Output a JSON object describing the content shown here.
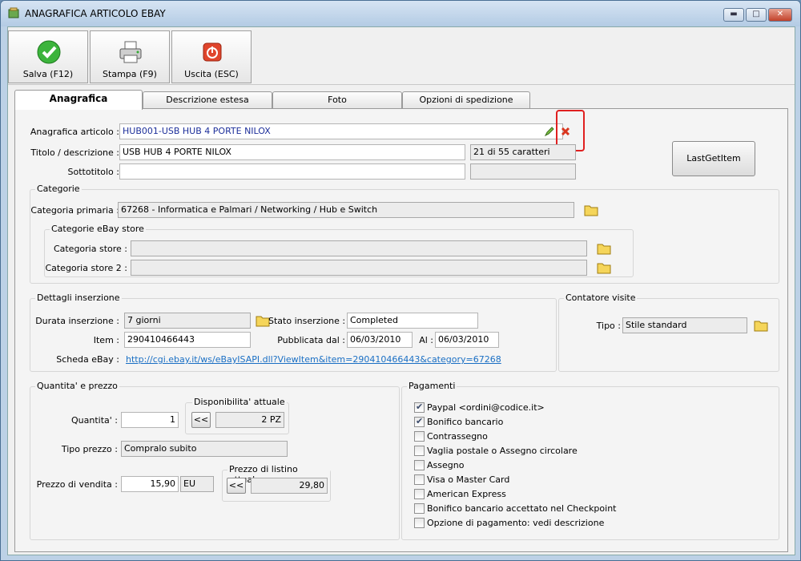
{
  "window": {
    "title": "ANAGRAFICA ARTICOLO EBAY",
    "minimize": "▬",
    "maximize": "□",
    "close": "✕"
  },
  "toolbar": {
    "save": "Salva (F12)",
    "print": "Stampa (F9)",
    "exit": "Uscita (ESC)"
  },
  "tabs": [
    "Anagrafica",
    "Descrizione estesa",
    "Foto",
    "Opzioni di spedizione"
  ],
  "anagrafica": {
    "article_label": "Anagrafica articolo :",
    "article_value": "HUB001-USB HUB 4 PORTE NILOX",
    "title_label": "Titolo / descrizione :",
    "title_value": "USB HUB 4 PORTE NILOX",
    "title_count": "21 di 55 caratteri",
    "subtitle_label": "Sottotitolo :",
    "subtitle_value": "",
    "last_get_item": "LastGetItem"
  },
  "categorie": {
    "group_title": "Categorie",
    "primary_label": "Categoria primaria :",
    "primary_value": "67268 - Informatica e Palmari / Networking / Hub e Switch",
    "store_group_title": "Categorie eBay store",
    "store_label": "Categoria store :",
    "store_value": "",
    "store2_label": "Categoria store 2 :",
    "store2_value": ""
  },
  "dettagli": {
    "group_title": "Dettagli inserzione",
    "duration_label": "Durata inserzione :",
    "duration_value": "7 giorni",
    "status_label": "Stato inserzione :",
    "status_value": "Completed",
    "item_label": "Item :",
    "item_value": "290410466443",
    "published_label": "Pubblicata dal :",
    "published_value": "06/03/2010",
    "to_label": "Al :",
    "to_value": "06/03/2010",
    "sheet_label": "Scheda eBay :",
    "sheet_link": "http://cgi.ebay.it/ws/eBayISAPI.dll?ViewItem&item=290410466443&category=67268"
  },
  "contatore": {
    "group_title": "Contatore visite",
    "type_label": "Tipo :",
    "type_value": "Stile standard"
  },
  "quantita": {
    "group_title": "Quantita' e prezzo",
    "qty_label": "Quantita' :",
    "qty_value": "1",
    "avail_title": "Disponibilita' attuale",
    "avail_value": "2 PZ",
    "price_type_label": "Tipo prezzo :",
    "price_type_value": "Compralo subito",
    "sale_price_label": "Prezzo di vendita :",
    "sale_price_value": "15,90",
    "currency": "EU",
    "list_price_title": "Prezzo di listino attuale",
    "list_price_value": "29,80",
    "copy_button": "<<"
  },
  "pagamenti": {
    "group_title": "Pagamenti",
    "items": [
      {
        "label": "Paypal <ordini@codice.it>",
        "checked": true
      },
      {
        "label": "Bonifico bancario",
        "checked": true
      },
      {
        "label": "Contrassegno",
        "checked": false
      },
      {
        "label": "Vaglia postale o Assegno circolare",
        "checked": false
      },
      {
        "label": "Assegno",
        "checked": false
      },
      {
        "label": "Visa o Master Card",
        "checked": false
      },
      {
        "label": "American Express",
        "checked": false
      },
      {
        "label": "Bonifico bancario accettato nel Checkpoint",
        "checked": false
      },
      {
        "label": "Opzione di pagamento: vedi descrizione",
        "checked": false
      }
    ]
  }
}
